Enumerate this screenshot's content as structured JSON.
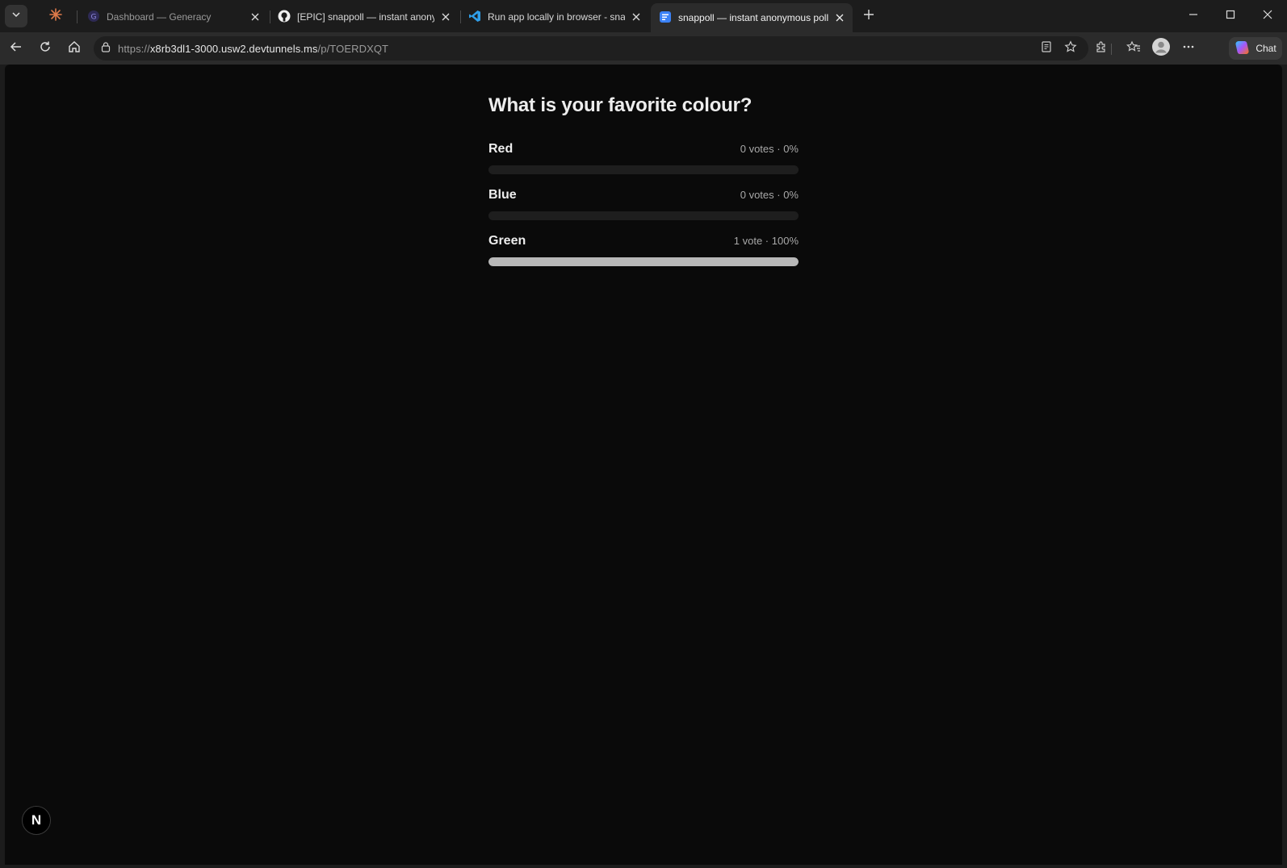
{
  "browser": {
    "tabs": [
      {
        "title": "Dashboard — Generacy",
        "active": false
      },
      {
        "title": "[EPIC] snappoll — instant anonymous polls",
        "active": false
      },
      {
        "title": "Run app locally in browser - snappoll",
        "active": false
      },
      {
        "title": "snappoll — instant anonymous polls",
        "active": true
      }
    ],
    "address": {
      "url_prefix": "https://",
      "url_host": "x8rb3dl1-3000.usw2.devtunnels.ms",
      "url_path": "/p/TOERDXQT"
    },
    "chat_label": "Chat"
  },
  "poll": {
    "question": "What is your favorite colour?",
    "options": [
      {
        "label": "Red",
        "meta": "0 votes · 0%",
        "percent": 0
      },
      {
        "label": "Blue",
        "meta": "0 votes · 0%",
        "percent": 0
      },
      {
        "label": "Green",
        "meta": "1 vote · 100%",
        "percent": 100
      }
    ]
  },
  "badge": {
    "letter": "N"
  },
  "colors": {
    "bar_fill": "#b8b8b8",
    "bar_track": "#1e1e1e",
    "page_bg": "#0a0a0a",
    "accent_blue": "#3b82f6"
  }
}
